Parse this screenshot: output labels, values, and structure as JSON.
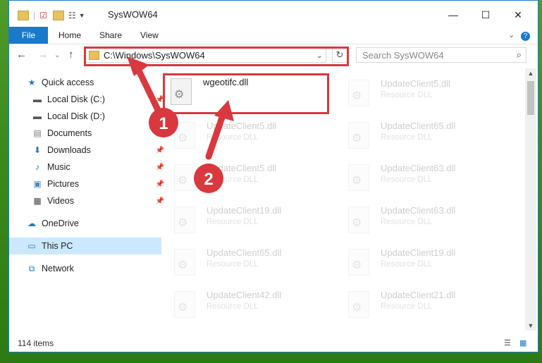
{
  "window": {
    "title": "SysWOW64"
  },
  "ribbon": {
    "tabs": [
      "File",
      "Home",
      "Share",
      "View"
    ]
  },
  "address": {
    "path": "C:\\Windows\\SysWOW64"
  },
  "search": {
    "placeholder": "Search SysWOW64"
  },
  "sidebar": {
    "items": [
      {
        "label": "Quick access",
        "icon": "star-icon"
      },
      {
        "label": "Local Disk (C:)",
        "icon": "drive-icon"
      },
      {
        "label": "Local Disk (D:)",
        "icon": "drive-icon"
      },
      {
        "label": "Documents",
        "icon": "documents-icon"
      },
      {
        "label": "Downloads",
        "icon": "downloads-icon"
      },
      {
        "label": "Music",
        "icon": "music-icon"
      },
      {
        "label": "Pictures",
        "icon": "pictures-icon"
      },
      {
        "label": "Videos",
        "icon": "videos-icon"
      },
      {
        "label": "OneDrive",
        "icon": "cloud-icon"
      },
      {
        "label": "This PC",
        "icon": "computer-icon"
      },
      {
        "label": "Network",
        "icon": "network-icon"
      }
    ]
  },
  "files": {
    "highlighted": {
      "name": "wgeotifc.dll"
    },
    "left_column": [
      {
        "name": "UpdateClient5.dll",
        "type": "Resource DLL"
      },
      {
        "name": "UpdateClient5.dll",
        "type": "Resource DLL"
      },
      {
        "name": "UpdateClient19.dll",
        "type": "Resource DLL"
      },
      {
        "name": "UpdateClient65.dll",
        "type": "Resource DLL"
      },
      {
        "name": "UpdateClient42.dll",
        "type": "Resource DLL"
      }
    ],
    "right_column": [
      {
        "name": "UpdateClient5.dll",
        "type": "Resource DLL"
      },
      {
        "name": "UpdateClient65.dll",
        "type": "Resource DLL"
      },
      {
        "name": "UpdateClient63.dll",
        "type": "Resource DLL"
      },
      {
        "name": "UpdateClient63.dll",
        "type": "Resource DLL"
      },
      {
        "name": "UpdateClient19.dll",
        "type": "Resource DLL"
      },
      {
        "name": "UpdateClient21.dll",
        "type": "Resource DLL"
      }
    ]
  },
  "status": {
    "item_count": "114 items"
  },
  "annotations": {
    "step1": "1",
    "step2": "2",
    "color": "#d9383f"
  }
}
